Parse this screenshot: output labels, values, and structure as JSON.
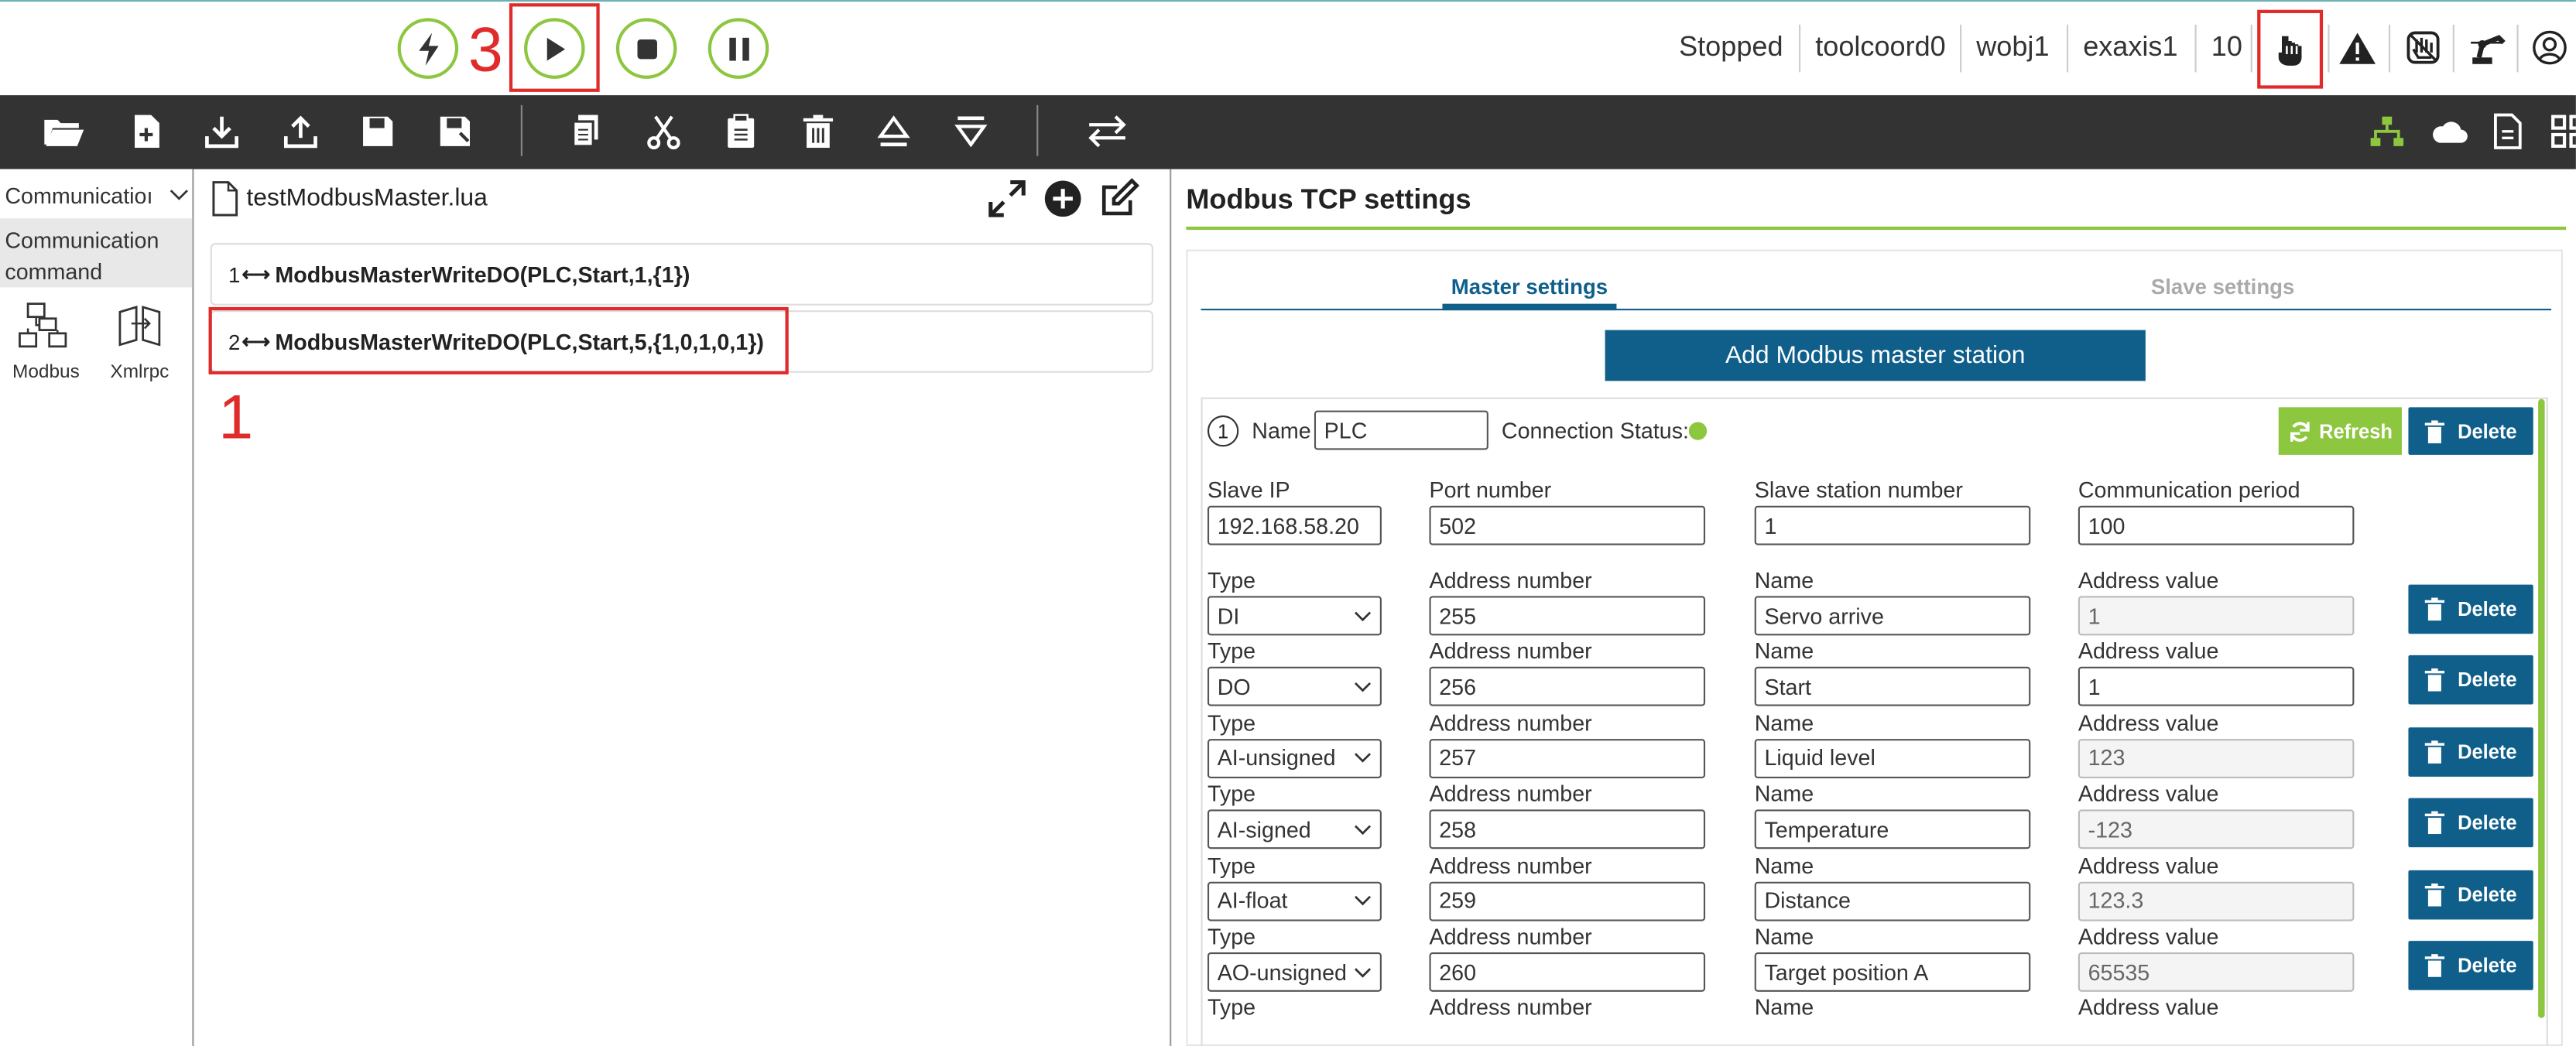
{
  "top": {
    "annotations": {
      "n1": "1",
      "n2": "2",
      "n3": "3"
    },
    "status": [
      "Stopped",
      "toolcoord0",
      "wobj1",
      "exaxis1",
      "10"
    ]
  },
  "sidebar": {
    "dropdown": "Communicatioı",
    "category": [
      "Communication",
      "command"
    ],
    "items": [
      {
        "label": "Modbus",
        "icon": "modbus-icon"
      },
      {
        "label": "Xmlrpc",
        "icon": "xmlrpc-icon"
      }
    ]
  },
  "editor": {
    "filename": "testModbusMaster.lua",
    "lines": [
      {
        "no": "1",
        "code": "ModbusMasterWriteDO(PLC,Start,1,{1})"
      },
      {
        "no": "2",
        "code": "ModbusMasterWriteDO(PLC,Start,5,{1,0,1,0,1})"
      }
    ]
  },
  "settings": {
    "title": "Modbus TCP settings",
    "tabs": [
      "Master settings",
      "Slave settings"
    ],
    "add_label": "Add Modbus master station",
    "station": {
      "index": "1",
      "name_label": "Name",
      "name": "PLC",
      "conn_label": "Connection Status:",
      "refresh": "Refresh",
      "delete": "Delete",
      "headers": [
        "Slave IP",
        "Port number",
        "Slave station number",
        "Communication period"
      ],
      "values": [
        "192.168.58.20",
        "502",
        "1",
        "100"
      ]
    },
    "col_labels": [
      "Type",
      "Address number",
      "Name",
      "Address value"
    ],
    "delete_label": "Delete",
    "rows": [
      {
        "type": "DI",
        "addr": "255",
        "name": "Servo arrive",
        "value": "1"
      },
      {
        "type": "DO",
        "addr": "256",
        "name": "Start",
        "value": "1"
      },
      {
        "type": "AI-unsigned",
        "addr": "257",
        "name": "Liquid level",
        "value": "123"
      },
      {
        "type": "AI-signed",
        "addr": "258",
        "name": "Temperature",
        "value": "-123"
      },
      {
        "type": "AI-float",
        "addr": "259",
        "name": "Distance",
        "value": "123.3"
      },
      {
        "type": "AO-unsigned",
        "addr": "260",
        "name": "Target position A",
        "value": "65535"
      }
    ],
    "last_labels": [
      "Type",
      "Address number",
      "Name",
      "Address value"
    ]
  },
  "colors": {
    "accent": "#8dc63f",
    "primary": "#0f5f8a",
    "highlight": "#e02b2b",
    "toolbar": "#333333"
  }
}
